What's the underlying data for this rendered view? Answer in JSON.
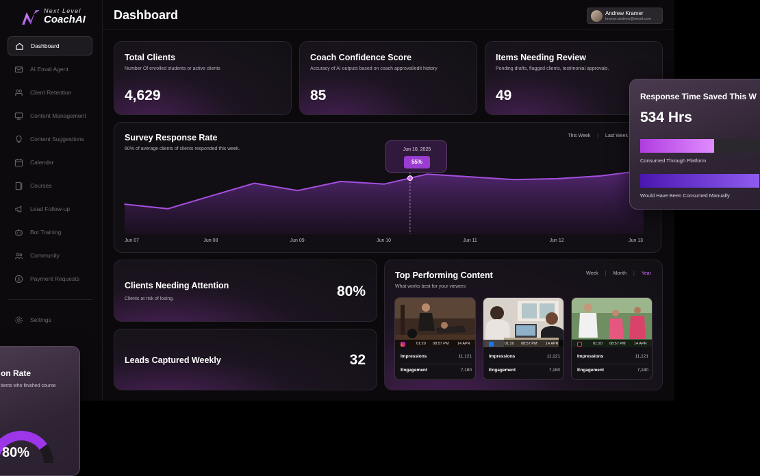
{
  "brand": {
    "tagline": "Next Level",
    "name": "CoachAI"
  },
  "colors": {
    "accent": "#a44fe0",
    "accent_bright": "#d46bff",
    "bg": "#0b090c"
  },
  "sidebar": {
    "items": [
      {
        "label": "Dashboard",
        "icon": "home-icon",
        "active": true
      },
      {
        "label": "AI Email Agent",
        "icon": "mail-icon"
      },
      {
        "label": "Client Retention",
        "icon": "retention-icon"
      },
      {
        "label": "Content Management",
        "icon": "monitor-icon"
      },
      {
        "label": "Content Suggestions",
        "icon": "bulb-icon"
      },
      {
        "label": "Calendar",
        "icon": "calendar-icon"
      },
      {
        "label": "Courses",
        "icon": "book-icon"
      },
      {
        "label": "Lead Follow-up",
        "icon": "megaphone-icon"
      },
      {
        "label": "Bot Training",
        "icon": "bot-icon"
      },
      {
        "label": "Community",
        "icon": "people-icon"
      },
      {
        "label": "Payment Requests",
        "icon": "dollar-icon"
      }
    ],
    "settings_label": "Settings"
  },
  "header": {
    "title": "Dashboard",
    "user": {
      "name": "Andrew Kramer",
      "email": "kramer.andrew@email.com"
    }
  },
  "kpis": [
    {
      "title": "Total Clients",
      "subtitle": "Number Of enrolled students or active clients",
      "value": "4,629"
    },
    {
      "title": "Coach Confidence Score",
      "subtitle": "Accuracy of AI outputs based on coach approval/edit history",
      "value": "85"
    },
    {
      "title": "Items Needing Review",
      "subtitle": "Pending drafts, flagged clients, testimonial approvals.",
      "value": "49"
    }
  ],
  "survey": {
    "title": "Survey Response Rate",
    "subtitle": "60% of average clients of clients responded this week.",
    "periods": [
      "This Week",
      "Last Week"
    ],
    "tooltip": {
      "date": "Jun 10, 2025",
      "value": "55%"
    }
  },
  "chart_data": {
    "type": "area",
    "title": "Survey Response Rate",
    "categories": [
      "Jun 07",
      "Jun 08",
      "Jun 09",
      "Jun 10",
      "Jun 11",
      "Jun 12",
      "Jun 13"
    ],
    "x": [
      0,
      0.5,
      1,
      1.5,
      2,
      2.5,
      3,
      3.5,
      4,
      4.5,
      5,
      5.5,
      6
    ],
    "values": [
      33,
      28,
      42,
      56,
      48,
      58,
      55,
      66,
      63,
      60,
      61,
      64,
      70
    ],
    "ylim": [
      0,
      100
    ],
    "highlight": {
      "x": 3.3,
      "label": "Jun 10, 2025",
      "value": "55%"
    }
  },
  "response_time": {
    "title": "Response Time Saved This W",
    "value": "534 Hrs",
    "bars": [
      {
        "label": "Consumed Through Platform",
        "fraction": 0.54
      },
      {
        "label": "Would Have Been Consumed Manually",
        "fraction": 0.87
      }
    ]
  },
  "clients_attention": {
    "title": "Clients Needing Attention",
    "subtitle": "Clients at risk of losing.",
    "value": "80%"
  },
  "leads": {
    "title": "Leads Captured Weekly",
    "value": "32"
  },
  "top_content": {
    "title": "Top Performing Content",
    "subtitle": "What works best for your viewers",
    "periods": [
      "Week",
      "Month",
      "Year"
    ],
    "active_period": "Year",
    "items": [
      {
        "platform": "instagram-icon",
        "duration": "01:20",
        "time": "08:57 PM",
        "date": "14 APR",
        "impressions_label": "Impressions",
        "impressions": "11,121",
        "engagement_label": "Engagement",
        "engagement": "7,180"
      },
      {
        "platform": "facebook-icon",
        "duration": "01:20",
        "time": "08:57 PM",
        "date": "14 APR",
        "impressions_label": "Impressions",
        "impressions": "11,121",
        "engagement_label": "Engagement",
        "engagement": "7,180"
      },
      {
        "platform": "tiktok-icon",
        "duration": "01:20",
        "time": "08:57 PM",
        "date": "14 APR",
        "impressions_label": "Impressions",
        "impressions": "11,121",
        "engagement_label": "Engagement",
        "engagement": "7,180"
      }
    ]
  },
  "completion": {
    "title": "on Rate",
    "subtitle": "tients who finished course",
    "value": "80%",
    "fraction": 0.8
  }
}
